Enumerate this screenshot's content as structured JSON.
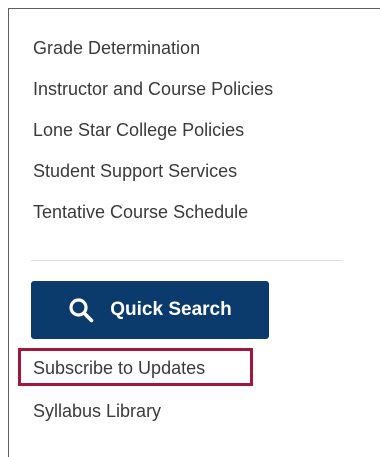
{
  "nav": {
    "items": [
      {
        "label": "Grade Determination"
      },
      {
        "label": "Instructor and Course Policies"
      },
      {
        "label": "Lone Star College Policies"
      },
      {
        "label": "Student Support Services"
      },
      {
        "label": "Tentative Course Schedule"
      }
    ]
  },
  "quick_search": {
    "label": "Quick Search",
    "icon": "search-icon",
    "bg_color": "#0b3a6c"
  },
  "links": {
    "subscribe": "Subscribe to Updates",
    "syllabus": "Syllabus Library"
  },
  "colors": {
    "highlight_border": "#a4163b",
    "text": "#3a3a3a"
  }
}
